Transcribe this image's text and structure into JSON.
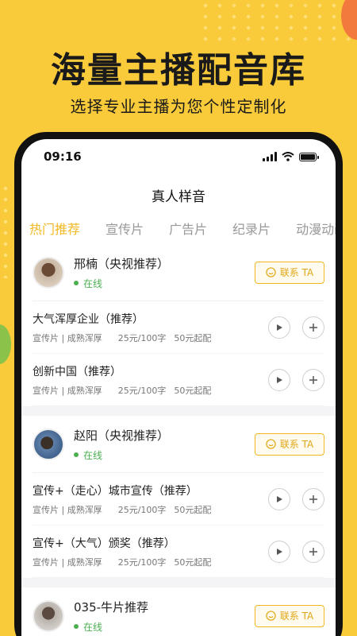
{
  "promo": {
    "headline": "海量主播配音库",
    "subline": "选择专业主播为您个性定制化"
  },
  "status_bar": {
    "time": "09:16"
  },
  "page": {
    "title": "真人样音"
  },
  "tabs": [
    {
      "label": "热门推荐",
      "active": true
    },
    {
      "label": "宣传片",
      "active": false
    },
    {
      "label": "广告片",
      "active": false
    },
    {
      "label": "纪录片",
      "active": false
    },
    {
      "label": "动漫动画",
      "active": false
    }
  ],
  "contact_label": "联系 TA",
  "anchors": [
    {
      "name": "邢楠（央视推荐）",
      "status": "在线",
      "samples": [
        {
          "title": "大气浑厚企业（推荐）",
          "tags": "宣传片 | 成熟浑厚",
          "price": "25元/100字",
          "start": "50元起配"
        },
        {
          "title": "创新中国（推荐）",
          "tags": "宣传片 | 成熟浑厚",
          "price": "25元/100字",
          "start": "50元起配"
        }
      ]
    },
    {
      "name": "赵阳（央视推荐）",
      "status": "在线",
      "samples": [
        {
          "title": "宣传+（走心）城市宣传（推荐）",
          "tags": "宣传片 | 成熟浑厚",
          "price": "25元/100字",
          "start": "50元起配"
        },
        {
          "title": "宣传+（大气）颁奖（推荐）",
          "tags": "宣传片 | 成熟浑厚",
          "price": "25元/100字",
          "start": "50元起配"
        }
      ]
    },
    {
      "name": "035-牛片推荐",
      "status": "在线",
      "samples": []
    }
  ],
  "colors": {
    "accent": "#F2B825",
    "online": "#4CAF50",
    "background": "#F9CB3A"
  },
  "icons": {
    "play": "play-icon",
    "add": "plus-icon",
    "contact": "smile-icon"
  }
}
